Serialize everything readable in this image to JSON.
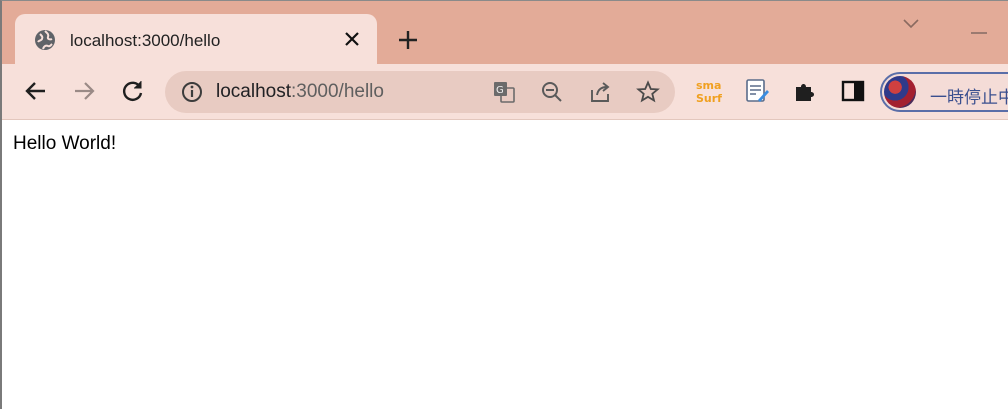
{
  "tab": {
    "title": "localhost:3000/hello"
  },
  "omnibox": {
    "host": "localhost",
    "path": ":3000/hello"
  },
  "profile": {
    "label": "一時停止中"
  },
  "page": {
    "text": "Hello World!"
  },
  "icons": {
    "favicon": "globe-icon",
    "tab_close": "close-icon",
    "new_tab": "plus-icon",
    "tab_search": "chevron-down-icon",
    "minimize": "minimize-icon",
    "back": "back-arrow-icon",
    "forward": "forward-arrow-icon",
    "reload": "reload-icon",
    "site_info": "info-icon",
    "translate": "translate-icon",
    "zoom": "zoom-out-icon",
    "share": "share-icon",
    "bookmark": "star-icon",
    "ext_smartsurf": "smartsurf-extension-icon",
    "ext_notes": "notes-extension-icon",
    "extensions": "puzzle-icon",
    "side_panel": "side-panel-icon"
  },
  "colors": {
    "tabstrip": "#e3ab98",
    "toolbar": "#f7e0da",
    "omnibox": "#e8cbc2",
    "smartsurf_orange": "#f0a020"
  }
}
